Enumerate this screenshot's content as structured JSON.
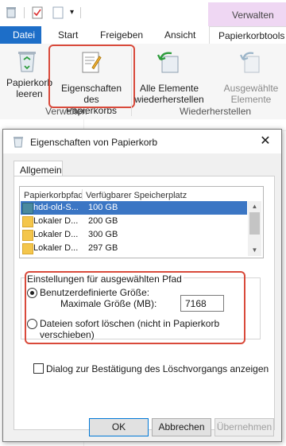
{
  "context_tab": {
    "label": "Verwalten"
  },
  "tabs": [
    {
      "label": "Datei"
    },
    {
      "label": "Start"
    },
    {
      "label": "Freigeben"
    },
    {
      "label": "Ansicht"
    },
    {
      "label": "Papierkorbtools"
    }
  ],
  "ribbon": {
    "buttons": [
      {
        "label": "Papierkorb leeren"
      },
      {
        "label": "Eigenschaften des Papierkorbs"
      },
      {
        "label": "Alle Elemente wiederherstellen"
      },
      {
        "label": "Ausgewählte Elemente wiederherstellen"
      }
    ],
    "groups": [
      {
        "label": "Verwalten"
      },
      {
        "label": "Wiederherstellen"
      }
    ]
  },
  "dialog": {
    "title": "Eigenschaften von Papierkorb",
    "tab": "Allgemein",
    "columns": [
      "Papierkorbpfad",
      "Verfügbarer Speicherplatz"
    ],
    "rows": [
      {
        "name": "hdd-old-S...",
        "size": "100 GB",
        "selected": true
      },
      {
        "name": "Lokaler D...",
        "size": "200 GB",
        "selected": false
      },
      {
        "name": "Lokaler D...",
        "size": "300 GB",
        "selected": false
      },
      {
        "name": "Lokaler D...",
        "size": "297 GB",
        "selected": false
      }
    ],
    "settings": {
      "legend": "Einstellungen für ausgewählten Pfad",
      "custom_size_label": "Benutzerdefinierte Größe:",
      "max_size_label": "Maximale Größe (MB):",
      "max_size_value": "7168",
      "delete_immediately_line1": "Dateien sofort löschen (nicht in Papierkorb",
      "delete_immediately_line2": "verschieben)",
      "selected_option": "custom"
    },
    "confirm_checkbox_label": "Dialog zur Bestätigung des Löschvorgangs anzeigen",
    "confirm_checked": false,
    "buttons": {
      "ok": "OK",
      "cancel": "Abbrechen",
      "apply": "Übernehmen"
    }
  }
}
